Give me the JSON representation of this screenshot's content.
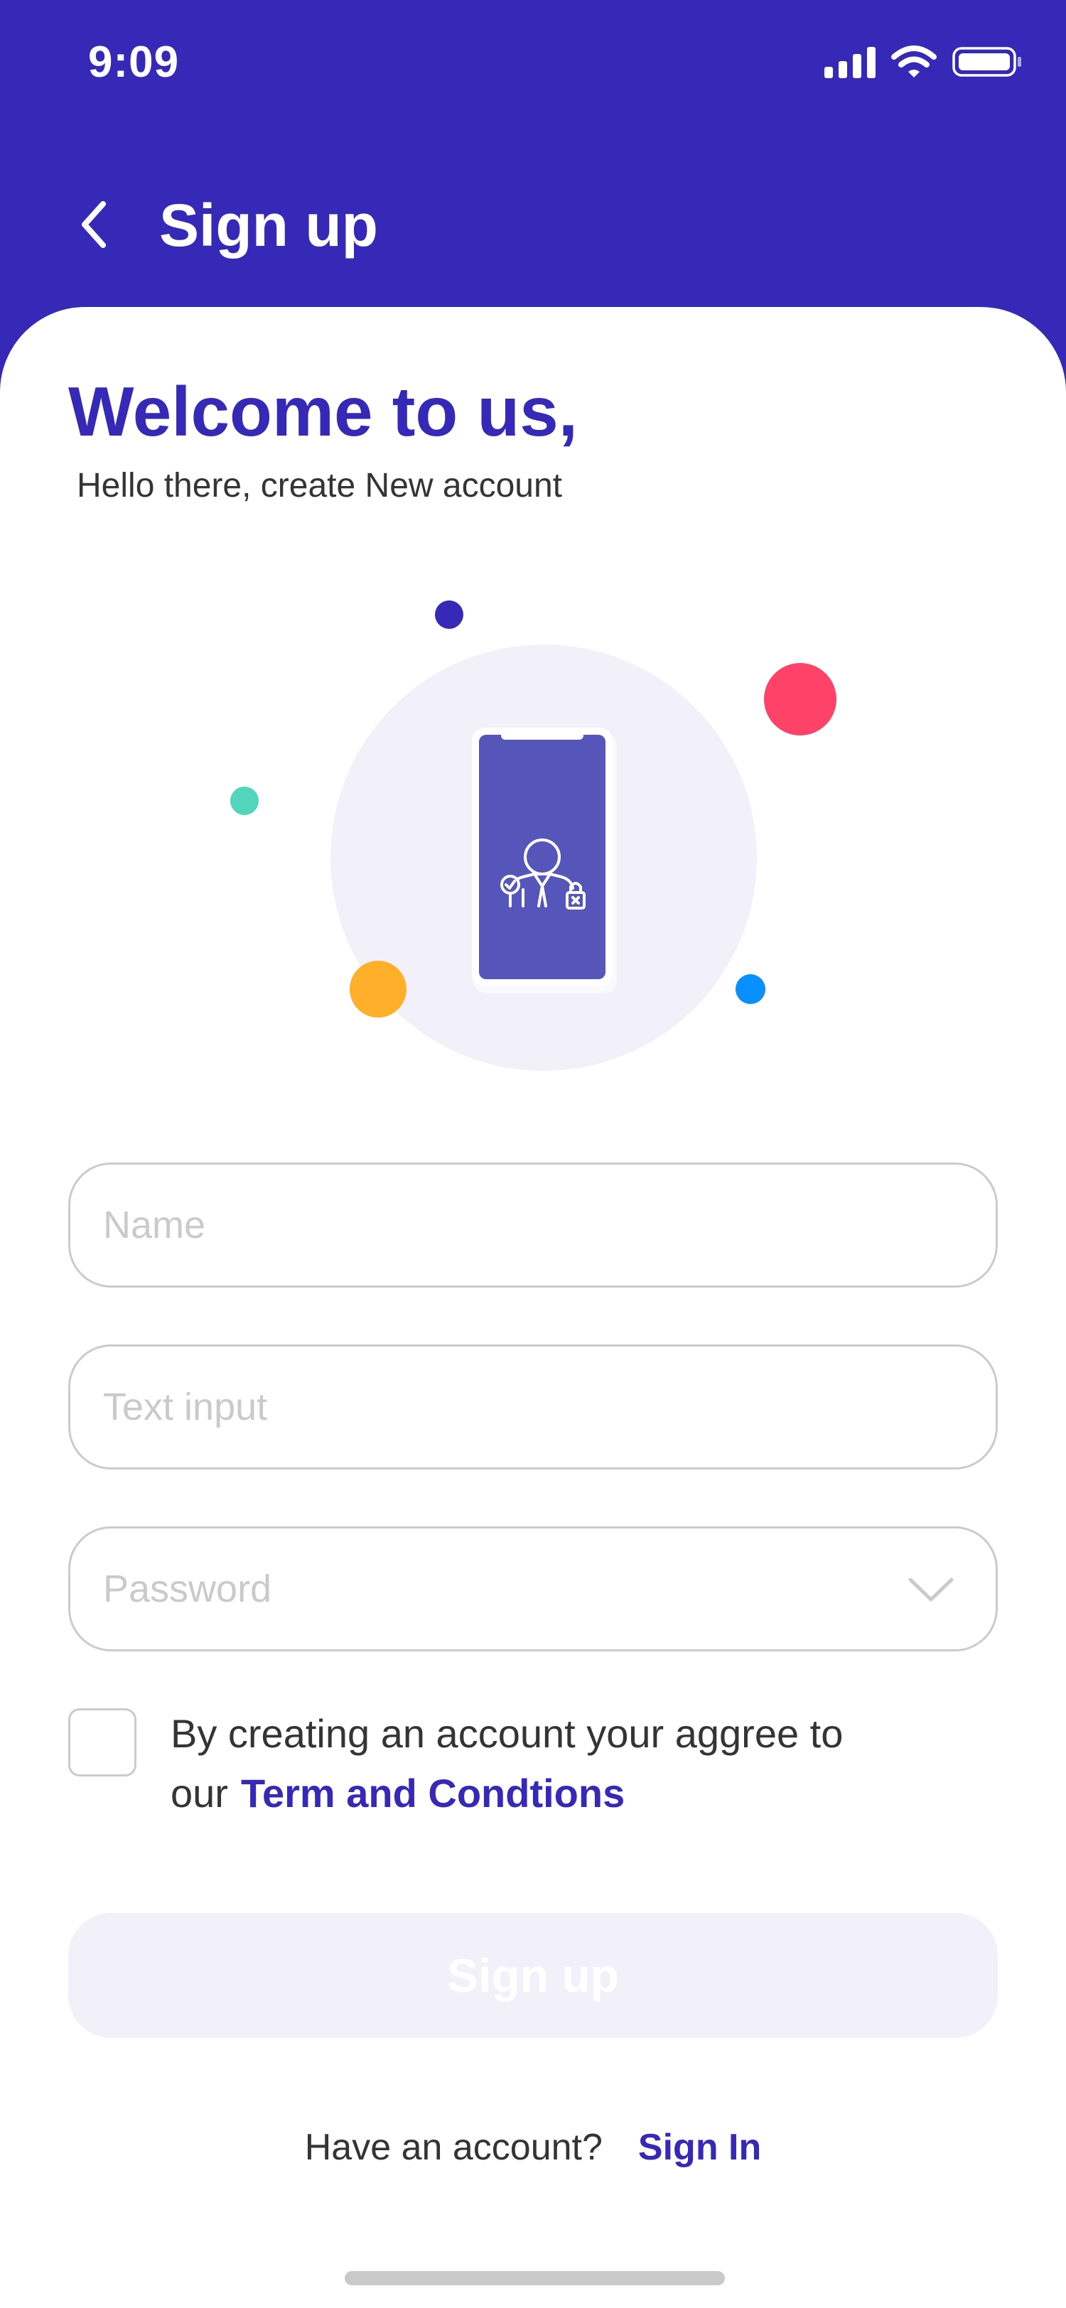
{
  "status_bar": {
    "time": "9:09"
  },
  "header": {
    "title": "Sign up"
  },
  "welcome": {
    "title": "Welcome to us,",
    "subtitle": "Hello there, create New account"
  },
  "form": {
    "name": {
      "placeholder": "Name",
      "value": ""
    },
    "text_input": {
      "placeholder": "Text input",
      "value": ""
    },
    "password": {
      "placeholder": "Password",
      "value": ""
    },
    "terms": {
      "text": "By creating an account your aggree to our",
      "link": "Term and Condtions",
      "checked": false
    },
    "submit_label": "Sign up"
  },
  "footer": {
    "prompt": "Have an account?",
    "link": "Sign In"
  },
  "colors": {
    "primary": "#3629B7",
    "phone_screen": "#5655B9",
    "circle_bg": "#F2F1F9",
    "dot_red": "#FF4267",
    "dot_orange": "#FFAF2A",
    "dot_teal": "#52D5BA",
    "dot_blue": "#0890FE",
    "border": "#CBCBCB",
    "placeholder": "#CACACA",
    "text": "#343434"
  },
  "icons": [
    "back-arrow-icon",
    "signal-icon",
    "wifi-icon",
    "battery-icon",
    "user-security-icon",
    "chevron-down-icon"
  ]
}
